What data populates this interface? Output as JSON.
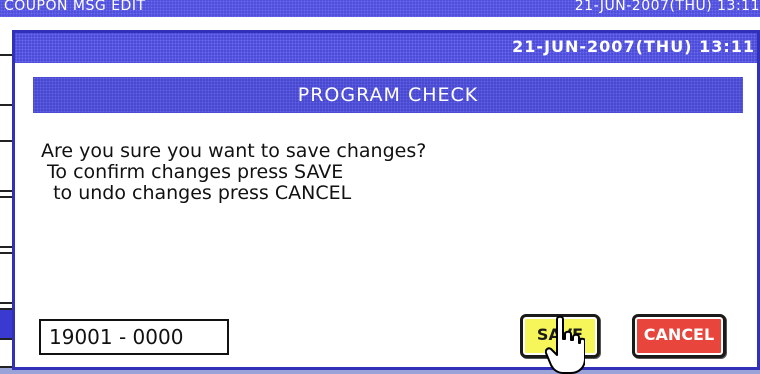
{
  "background": {
    "title": "COUPON MSG EDIT",
    "datetime": "21-JUN-2007(THU) 13:11"
  },
  "dialog": {
    "datetime": "21-JUN-2007(THU) 13:11",
    "header": "PROGRAM CHECK",
    "message": "Are you sure you want to save changes?\n To confirm changes press SAVE\n  to undo changes press CANCEL",
    "code_value": "19001 - 0000",
    "save_label": "SAVE",
    "cancel_label": "CANCEL"
  },
  "colors": {
    "titlebar": "#4646d4",
    "save_button": "#f6f65a",
    "cancel_button": "#e8463c"
  },
  "icons": {
    "pointer": "hand-pointer-icon"
  }
}
